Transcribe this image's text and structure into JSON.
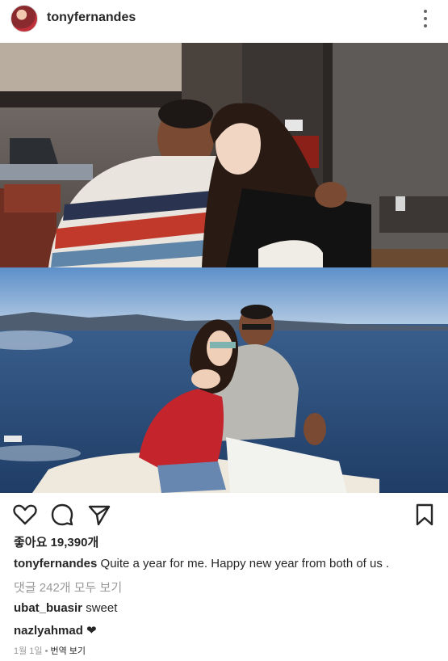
{
  "header": {
    "username": "tonyfernandes",
    "avatar_icon": "profile-avatar",
    "more_icon": "vertical-dots-icon"
  },
  "post": {
    "photos": [
      {
        "name": "indoor-couple-photo"
      },
      {
        "name": "seaside-couple-photo"
      }
    ],
    "actions": {
      "like_icon": "heart-outline-icon",
      "comment_icon": "comment-bubble-icon",
      "share_icon": "paper-plane-icon",
      "save_icon": "bookmark-icon"
    },
    "likes": "좋아요 19,390개",
    "caption": {
      "username": "tonyfernandes",
      "text": "Quite a year for me. Happy new year from both of us ."
    },
    "view_all_comments": "댓글 242개 모두 보기",
    "comments": [
      {
        "username": "ubat_buasir",
        "text": "sweet"
      },
      {
        "username": "nazlyahmad",
        "text": "❤"
      }
    ],
    "date": "1월 1일",
    "separator": " • ",
    "translate": "번역 보기"
  }
}
